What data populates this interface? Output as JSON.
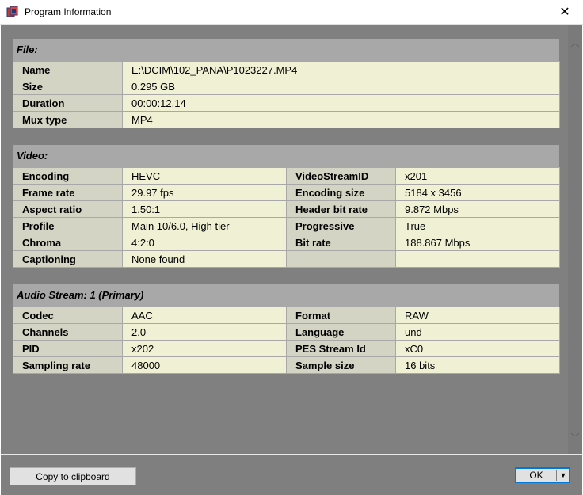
{
  "window": {
    "title": "Program Information",
    "close_symbol": "✕"
  },
  "file_section": {
    "header": "File:",
    "rows": [
      {
        "label": "Name",
        "value": "E:\\DCIM\\102_PANA\\P1023227.MP4"
      },
      {
        "label": "Size",
        "value": "0.295 GB"
      },
      {
        "label": "Duration",
        "value": "00:00:12.14"
      },
      {
        "label": "Mux type",
        "value": "MP4"
      }
    ]
  },
  "video_section": {
    "header": "Video:",
    "rows": [
      {
        "label": "Encoding",
        "value": "HEVC",
        "label2": "VideoStreamID",
        "value2": "x201"
      },
      {
        "label": "Frame rate",
        "value": "29.97 fps",
        "label2": "Encoding size",
        "value2": "5184 x 3456"
      },
      {
        "label": "Aspect ratio",
        "value": "1.50:1",
        "label2": "Header bit rate",
        "value2": "9.872 Mbps"
      },
      {
        "label": "Profile",
        "value": "Main 10/6.0, High tier",
        "label2": "Progressive",
        "value2": "True"
      },
      {
        "label": "Chroma",
        "value": "4:2:0",
        "label2": "Bit rate",
        "value2": "188.867 Mbps"
      },
      {
        "label": "Captioning",
        "value": "None found",
        "label2": "",
        "value2": ""
      }
    ]
  },
  "audio_section": {
    "header": "Audio Stream: 1 (Primary)",
    "rows": [
      {
        "label": "Codec",
        "value": "AAC",
        "label2": "Format",
        "value2": "RAW"
      },
      {
        "label": "Channels",
        "value": "2.0",
        "label2": "Language",
        "value2": "und"
      },
      {
        "label": "PID",
        "value": "x202",
        "label2": "PES Stream Id",
        "value2": "xC0"
      },
      {
        "label": "Sampling rate",
        "value": "48000",
        "label2": "Sample size",
        "value2": "16 bits"
      }
    ]
  },
  "footer": {
    "copy_label": "Copy to clipboard",
    "ok_label": "OK",
    "ok_dropdown_symbol": "▼"
  },
  "scrollbar": {
    "up_symbol": "︿",
    "down_symbol": "﹀"
  },
  "colors": {
    "background": "#808080",
    "section": "#a8a8a8",
    "label_cell": "#d4d4c4",
    "value_cell": "#f0f0d4",
    "focus_border": "#0078d7"
  }
}
